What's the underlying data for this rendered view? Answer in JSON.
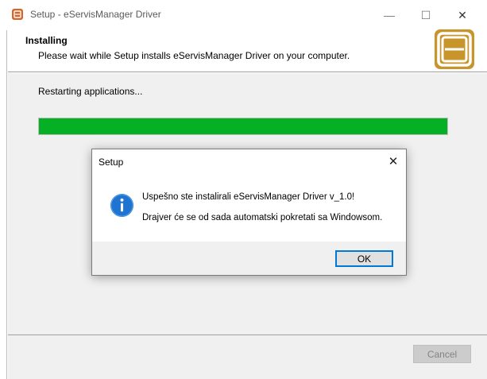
{
  "window": {
    "title": "Setup - eServisManager Driver",
    "minimize_glyph": "—",
    "maximize_glyph": "☐",
    "close_glyph": "✕"
  },
  "header": {
    "title": "Installing",
    "subtitle": "Please wait while Setup installs eServisManager Driver on your computer."
  },
  "main": {
    "status": "Restarting applications...",
    "progress_percent": 100
  },
  "footer": {
    "cancel_label": "Cancel"
  },
  "dialog": {
    "title": "Setup",
    "close_glyph": "✕",
    "message_line1": "Uspešno ste instalirali eServisManager Driver v_1.0!",
    "message_line2": "Drajver će se od sada automatski pokretati sa Windowsom.",
    "ok_label": "OK",
    "icon": "info-icon"
  },
  "colors": {
    "progress": "#06b025",
    "logo_gold": "#c8952a",
    "info_blue": "#1e74d0"
  }
}
